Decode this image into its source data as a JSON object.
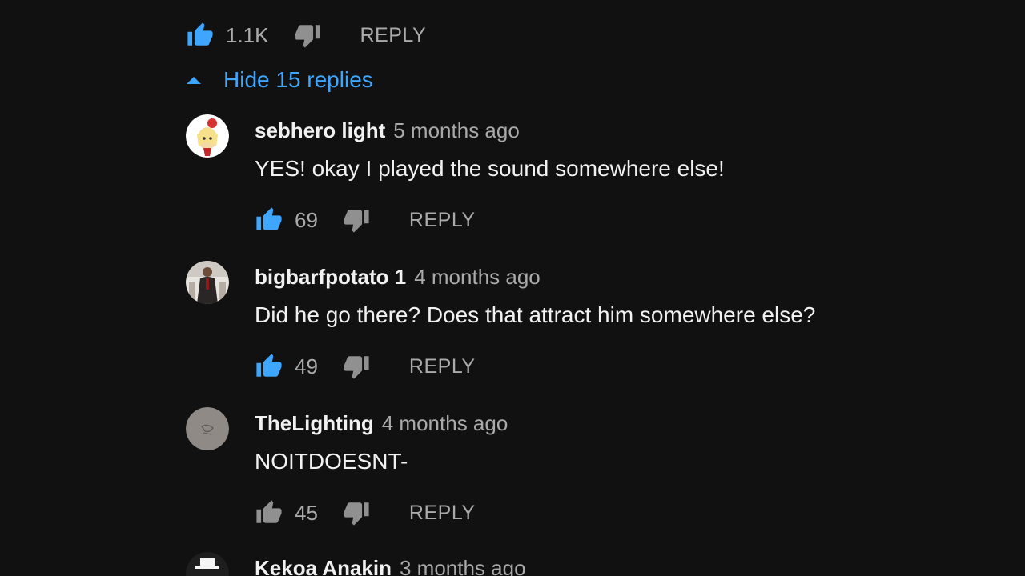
{
  "parent_comment": {
    "like_count": "1.1K",
    "reply_label": "REPLY",
    "like_icon": "thumbs-up-icon",
    "dislike_icon": "thumbs-down-icon",
    "like_active": true
  },
  "replies_toggle": {
    "label": "Hide 15 replies",
    "icon": "caret-up-icon"
  },
  "colors": {
    "background": "#111111",
    "accent_blue": "#3ea6ff",
    "text_primary": "#f1f1f1",
    "text_secondary": "#aaaaaa"
  },
  "replies": [
    {
      "author": "sebhero light",
      "time": "5 months ago",
      "text": "YES! okay I played the sound somewhere else!",
      "like_count": "69",
      "reply_label": "REPLY",
      "like_active": true,
      "avatar_icon": "cartoon-avatar"
    },
    {
      "author": "bigbarfpotato 1",
      "time": "4 months ago",
      "text": "Did he go there? Does that attract him somewhere else?",
      "like_count": "49",
      "reply_label": "REPLY",
      "like_active": true,
      "avatar_icon": "photo-avatar"
    },
    {
      "author": "TheLighting",
      "time": "4 months ago",
      "text": "NOITDOESNT-",
      "like_count": "45",
      "reply_label": "REPLY",
      "like_active": false,
      "avatar_icon": "sketch-avatar"
    },
    {
      "author": "Kekoa Anakin",
      "time": "3 months ago",
      "avatar_icon": "hat-avatar"
    }
  ]
}
